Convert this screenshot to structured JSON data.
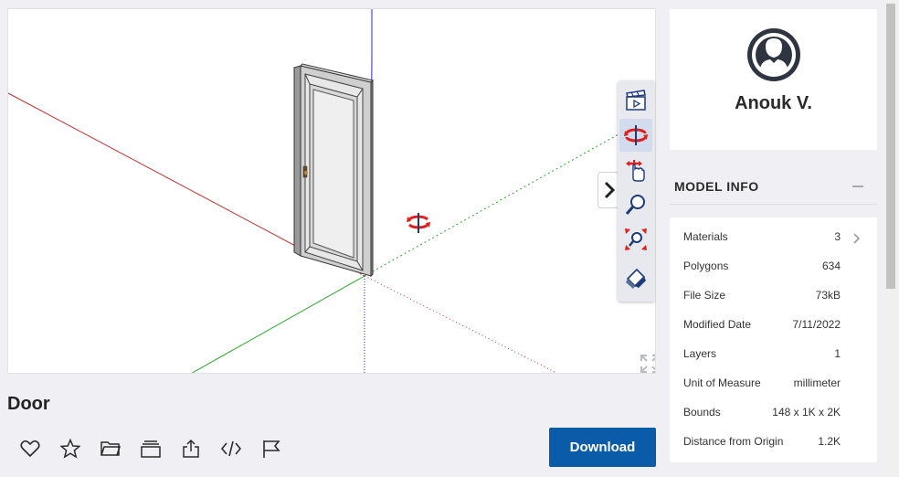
{
  "model": {
    "title": "Door"
  },
  "download_label": "Download",
  "author": {
    "name": "Anouk V.",
    "avatar_icon": "user-avatar-icon"
  },
  "model_info": {
    "header": "MODEL INFO",
    "rows": [
      {
        "label": "Materials",
        "value": "3"
      },
      {
        "label": "Polygons",
        "value": "634"
      },
      {
        "label": "File Size",
        "value": "73kB"
      },
      {
        "label": "Modified Date",
        "value": "7/11/2022"
      },
      {
        "label": "Layers",
        "value": "1"
      },
      {
        "label": "Unit of Measure",
        "value": "millimeter"
      },
      {
        "label": "Bounds",
        "value": "148 x 1K x 2K"
      },
      {
        "label": "Distance from Origin",
        "value": "1.2K"
      }
    ]
  },
  "viewer_tools": [
    "scenes-icon",
    "orbit-icon",
    "pan-icon",
    "zoom-icon",
    "zoom-extents-icon",
    "section-eraser-icon"
  ],
  "action_icons": [
    "heart-icon",
    "star-icon",
    "folder-icon",
    "collection-icon",
    "share-icon",
    "embed-icon",
    "flag-icon"
  ],
  "colors": {
    "accent": "#0a5ca8",
    "axis_red": "#cc2222",
    "axis_green": "#22aa22",
    "axis_blue": "#2222cc",
    "orbit_red": "#e0201c"
  }
}
